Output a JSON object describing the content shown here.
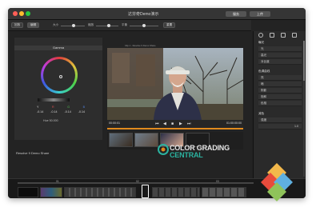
{
  "window": {
    "title": "达芬奇Demo演示",
    "buttons": [
      "服务",
      "上传"
    ]
  },
  "toolbar": {
    "tabs": [
      "回放",
      "编辑",
      "调色"
    ],
    "tools": [
      "大小",
      "缩放",
      "平衡",
      "重置"
    ]
  },
  "color_panel": {
    "title": "Gamma",
    "channels": [
      "Y",
      "R",
      "G",
      "B"
    ],
    "values": [
      "-0.14",
      "-0.14",
      "-0.14",
      "-0.14"
    ],
    "hue": "Hue 50.000",
    "clip_name": "Resolve 9 Demo Share"
  },
  "viewer": {
    "title": "Clip 1 - Resolve 9 Demo Share",
    "timecode_left": "00:00:01",
    "timecode_right": "01:00:00:00"
  },
  "watermark": {
    "line1": "COLOR GRADING",
    "line2": "CENTRAL"
  },
  "right_panel": {
    "sections": [
      {
        "label": "曝光",
        "rows": [
          "光",
          "高光",
          "对比度"
        ]
      },
      {
        "label": "色调曲线",
        "rows": [
          "亮",
          "暗",
          "阴影",
          "饱和",
          "色相"
        ]
      },
      {
        "label": "减色",
        "rows": [
          "强度",
          "1.0"
        ]
      }
    ]
  },
  "timeline": {
    "labels": [
      "01",
      "02",
      "03"
    ]
  },
  "colors": {
    "accent": "#e08a1e",
    "window_bg": "#232323",
    "panel_bg": "#2d2d2d",
    "logo_teal": "#2bb3a0"
  }
}
